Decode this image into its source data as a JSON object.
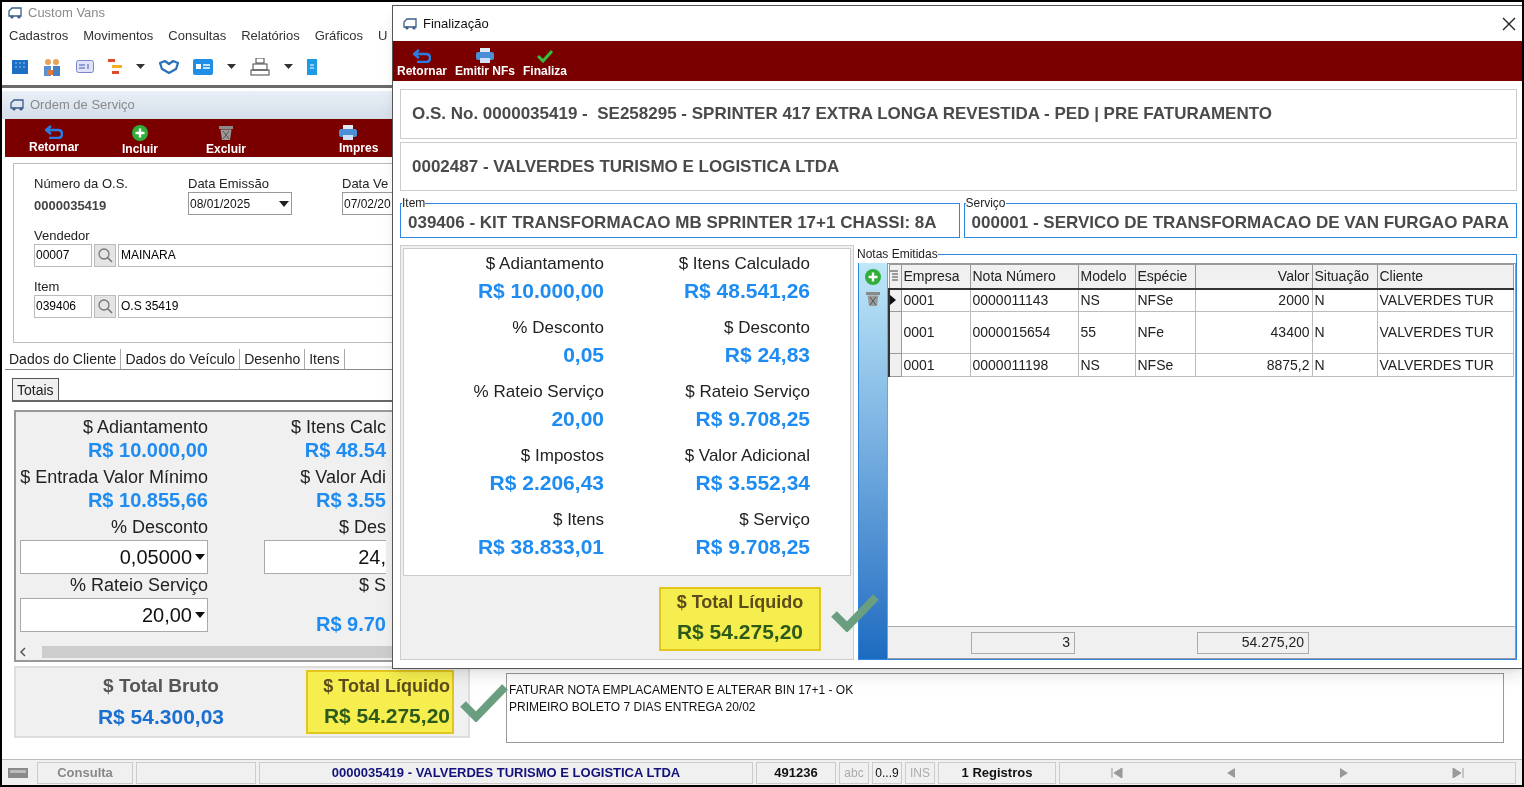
{
  "app": {
    "title": "Custom Vans",
    "menu": [
      "Cadastros",
      "Movimentos",
      "Consultas",
      "Relatórios",
      "Gráficos",
      "U"
    ]
  },
  "os_window": {
    "title": "Ordem de Serviço",
    "toolbar": [
      {
        "label": "Retornar"
      },
      {
        "label": "Incluir"
      },
      {
        "label": "Excluir"
      },
      {
        "label": "Impres"
      }
    ],
    "numero": {
      "label": "Número da O.S.",
      "value": "0000035419"
    },
    "data_emissao": {
      "label": "Data Emissão",
      "value": "08/01/2025"
    },
    "data_ve": {
      "label": "Data Ve",
      "value": "07/02/20"
    },
    "vendedor": {
      "label": "Vendedor",
      "code": "00007",
      "name": "MAINARA"
    },
    "item": {
      "label": "Item",
      "code": "039406",
      "name": "O.S 35419"
    },
    "tabs": [
      {
        "label": "Dados do Cliente",
        "selected": false
      },
      {
        "label": "Dados do Veículo",
        "selected": false
      },
      {
        "label": "Desenho",
        "selected": false
      },
      {
        "label": "Itens",
        "selected": false
      }
    ],
    "subtabs": [
      {
        "label": "Totais",
        "selected": true
      }
    ],
    "totals": [
      {
        "kind": "value",
        "label": "$ Adiantamento",
        "value": "R$ 10.000,00"
      },
      {
        "kind": "value",
        "label": "$ Itens Calc",
        "value": "R$ 48.54"
      },
      {
        "kind": "value",
        "label": "$ Entrada Valor Mínimo",
        "value": "R$ 10.855,66"
      },
      {
        "kind": "value",
        "label": "$ Valor Adi",
        "value": "R$ 3.55"
      },
      {
        "kind": "dropdown",
        "label": "% Desconto",
        "value": "0,05000"
      },
      {
        "kind": "input",
        "label": "$ Des",
        "value": "24,"
      },
      {
        "kind": "dropdown",
        "label": "% Rateio Serviço",
        "value": "20,00"
      },
      {
        "kind": "value",
        "label": "$ S",
        "value": "R$ 9.70"
      }
    ],
    "total_bruto": {
      "label": "$ Total Bruto",
      "value": "R$ 54.300,03"
    },
    "total_liquido": {
      "label": "$ Total Líquido",
      "value": "R$ 54.275,20"
    },
    "notes": [
      "FATURAR NOTA EMPLACAMENTO E ALTERAR BIN 17+1 - OK",
      "PRIMEIRO BOLETO 7 DIAS ENTREGA 20/02"
    ]
  },
  "dialog": {
    "title": "Finalização",
    "toolbar": [
      {
        "label": "Retornar"
      },
      {
        "label": "Emitir NFs"
      },
      {
        "label": "Finaliza"
      }
    ],
    "os_line": "O.S. No. 0000035419 -  SE258295 - SPRINTER 417 EXTRA LONGA REVESTIDA - PED | PRE FATURAMENTO",
    "client_line": "0002487 - VALVERDES TURISMO E LOGISTICA LTDA",
    "item": {
      "label": "Item",
      "value": "039406 - KIT TRANSFORMACAO MB SPRINTER 17+1 CHASSI: 8A"
    },
    "servico": {
      "label": "Serviço",
      "value": "000001 - SERVICO DE TRANSFORMACAO DE VAN FURGAO PARA"
    },
    "summary": [
      {
        "label": "$ Adiantamento",
        "value": "R$ 10.000,00"
      },
      {
        "label": "$ Itens Calculado",
        "value": "R$ 48.541,26"
      },
      {
        "label": "% Desconto",
        "value": "0,05"
      },
      {
        "label": "$ Desconto",
        "value": "R$ 24,83"
      },
      {
        "label": "% Rateio Serviço",
        "value": "20,00"
      },
      {
        "label": "$ Rateio Serviço",
        "value": "R$ 9.708,25"
      },
      {
        "label": "$ Impostos",
        "value": "R$ 2.206,43"
      },
      {
        "label": "$ Valor Adicional",
        "value": "R$ 3.552,34"
      },
      {
        "label": "$ Itens",
        "value": "R$ 38.833,01"
      },
      {
        "label": "$ Serviço",
        "value": "R$ 9.708,25"
      }
    ],
    "total_liquido": {
      "label": "$ Total Líquido",
      "value": "R$ 54.275,20"
    },
    "notas": {
      "title": "Notas Emitidas",
      "columns": [
        "Empresa",
        "Nota Número",
        "Modelo",
        "Espécie",
        "Valor",
        "Situação",
        "Cliente"
      ],
      "rows": [
        {
          "selected": true,
          "cells": [
            "0001",
            "0000011143",
            "NS",
            "NFSe",
            "2000",
            "N",
            "VALVERDES TUR"
          ]
        },
        {
          "selected": false,
          "cells": [
            "0001",
            "0000015654",
            "55",
            "NFe",
            "43400",
            "N",
            "VALVERDES TUR"
          ]
        },
        {
          "selected": false,
          "cells": [
            "0001",
            "0000011198",
            "NS",
            "NFSe",
            "8875,2",
            "N",
            "VALVERDES TUR"
          ]
        }
      ],
      "footer": {
        "count": "3",
        "sum": "54.275,20"
      }
    }
  },
  "status_bar": {
    "mode": "Consulta",
    "record": "0000035419 - VALVERDES TURISMO E LOGISTICA LTDA",
    "code": "491236",
    "indicators": [
      {
        "label": "abc",
        "on": false
      },
      {
        "label": "0...9",
        "on": true
      },
      {
        "label": "INS",
        "on": false
      }
    ],
    "count": "1 Registros"
  }
}
